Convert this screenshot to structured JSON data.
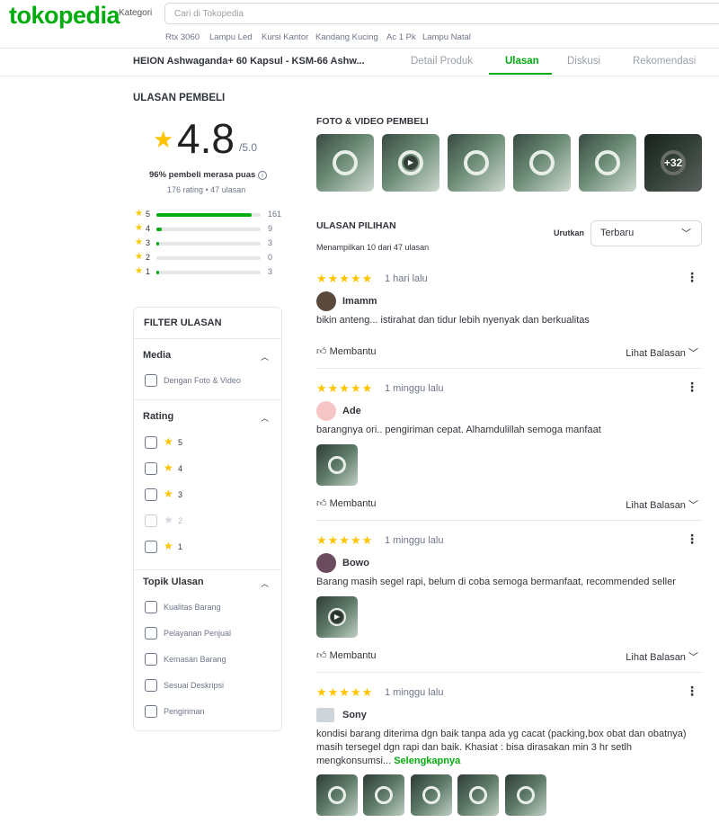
{
  "header": {
    "logo": "tokopedia",
    "kategori": "Kategori",
    "search_placeholder": "Cari di Tokopedia",
    "keywords": [
      "Rtx 3060",
      "Lampu Led",
      "Kursi Kantor",
      "Kandang Kucing",
      "Ac 1 Pk",
      "Lampu Natal"
    ]
  },
  "product_nav": {
    "title": "HEION Ashwaganda+ 60 Kapsul - KSM-66 Ashw...",
    "tabs": [
      "Detail Produk",
      "Ulasan",
      "Diskusi",
      "Rekomendasi"
    ],
    "active_tab": "Ulasan"
  },
  "summary": {
    "heading": "ULASAN PEMBELI",
    "rating": "4.8",
    "rating_of": "/5.0",
    "satisfied": "96% pembeli merasa puas",
    "counts": "176 rating • 47 ulasan",
    "breakdown": [
      {
        "star": "5",
        "count": "161",
        "fraction": 0.915
      },
      {
        "star": "4",
        "count": "9",
        "fraction": 0.05
      },
      {
        "star": "3",
        "count": "3",
        "fraction": 0.017
      },
      {
        "star": "2",
        "count": "0",
        "fraction": 0
      },
      {
        "star": "1",
        "count": "3",
        "fraction": 0.017
      }
    ]
  },
  "filter": {
    "title": "FILTER ULASAN",
    "media": {
      "label": "Media",
      "options": [
        "Dengan Foto & Video"
      ]
    },
    "rating": {
      "label": "Rating",
      "options": [
        "5",
        "4",
        "3",
        "2",
        "1"
      ]
    },
    "topik": {
      "label": "Topik Ulasan",
      "options": [
        "Kualitas Barang",
        "Pelayanan Penjual",
        "Kemasan Barang",
        "Sesuai Deskripsi",
        "Pengiriman"
      ]
    }
  },
  "media": {
    "heading": "FOTO & VIDEO PEMBELI",
    "more_count": "+32"
  },
  "reviews_header": {
    "heading": "ULASAN PILIHAN",
    "showing": "Menampilkan 10 dari 47 ulasan",
    "sort_label": "Urutkan",
    "sort_value": "Terbaru"
  },
  "reviews": [
    {
      "when": "1 hari lalu",
      "user": "Imamm",
      "text": "bikin anteng... istirahat dan tidur lebih nyenyak dan berkualitas",
      "helpful": "Membantu",
      "replies": "Lihat Balasan"
    },
    {
      "when": "1 minggu lalu",
      "user": "Ade",
      "text": "barangnya ori.. pengiriman cepat. Alhamdulillah semoga manfaat",
      "helpful": "Membantu",
      "replies": "Lihat Balasan"
    },
    {
      "when": "1 minggu lalu",
      "user": "Bowo",
      "text": "Barang masih segel rapi, belum di coba semoga bermanfaat, recommended seller",
      "helpful": "Membantu",
      "replies": "Lihat Balasan"
    },
    {
      "when": "1 minggu lalu",
      "user": "Sony",
      "text": "kondisi barang diterima dgn baik tanpa ada yg cacat (packing,box obat dan obatnya) masih tersegel dgn rapi dan baik. Khasiat : bisa dirasakan min 3 hr setlh mengkonsumsi...",
      "more": "Selengkapnya"
    }
  ],
  "colors": {
    "brand": "#03ac0e",
    "star": "#ffc400"
  }
}
